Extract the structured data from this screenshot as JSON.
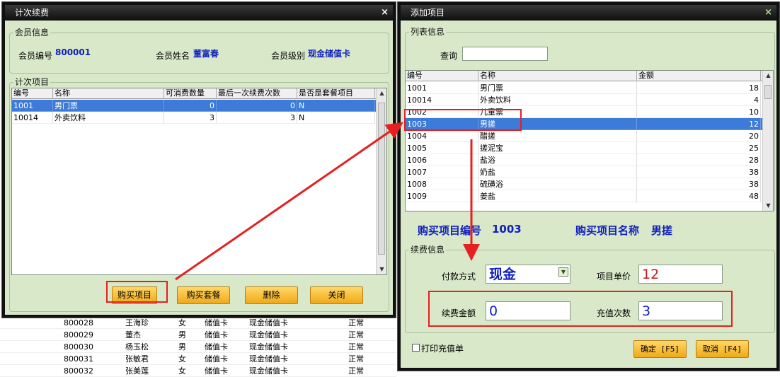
{
  "background_table": {
    "rows": [
      {
        "id": "800028",
        "name": "王海珍",
        "gender": "女",
        "card": "储值卡",
        "type": "现金储值卡",
        "status": "正常"
      },
      {
        "id": "800029",
        "name": "董杰",
        "gender": "男",
        "card": "储值卡",
        "type": "现金储值卡",
        "status": "正常"
      },
      {
        "id": "800030",
        "name": "杨玉松",
        "gender": "男",
        "card": "储值卡",
        "type": "现金储值卡",
        "status": "正常"
      },
      {
        "id": "800031",
        "name": "张敏君",
        "gender": "女",
        "card": "储值卡",
        "type": "现金储值卡",
        "status": "正常"
      },
      {
        "id": "800032",
        "name": "张美莲",
        "gender": "女",
        "card": "储值卡",
        "type": "现金储值卡",
        "status": "正常"
      }
    ]
  },
  "left_window": {
    "title": "计次续费",
    "close": "×",
    "member_group": {
      "legend": "会员信息",
      "id_label": "会员编号",
      "id_value": "800001",
      "name_label": "会员姓名",
      "name_value": "董富春",
      "level_label": "会员级别",
      "level_value": "现金储值卡"
    },
    "items_group": {
      "legend": "计次项目",
      "columns": [
        "编号",
        "名称",
        "可消费数量",
        "最后一次续费次数",
        "是否是套餐项目"
      ],
      "rows": [
        {
          "id": "1001",
          "name": "男门票",
          "qty": "0",
          "last": "0",
          "pkg": "N",
          "selected": true
        },
        {
          "id": "10014",
          "name": "外卖饮料",
          "qty": "3",
          "last": "3",
          "pkg": "N",
          "selected": false
        }
      ]
    },
    "buttons": {
      "buy_item": "购买项目",
      "buy_package": "购买套餐",
      "delete": "删除",
      "close": "关闭"
    }
  },
  "right_window": {
    "title": "添加项目",
    "close": "×",
    "list_group": {
      "legend": "列表信息",
      "query_label": "查询",
      "query_value": "",
      "columns": [
        "编号",
        "名称",
        "金额"
      ],
      "rows": [
        {
          "id": "1001",
          "name": "男门票",
          "amount": "18",
          "selected": false
        },
        {
          "id": "10014",
          "name": "外卖饮料",
          "amount": "4",
          "selected": false
        },
        {
          "id": "1002",
          "name": "儿童票",
          "amount": "10",
          "selected": false
        },
        {
          "id": "1003",
          "name": "男搓",
          "amount": "12",
          "selected": true
        },
        {
          "id": "1004",
          "name": "醋搓",
          "amount": "20",
          "selected": false
        },
        {
          "id": "1005",
          "name": "搓泥宝",
          "amount": "25",
          "selected": false
        },
        {
          "id": "1006",
          "name": "盐浴",
          "amount": "28",
          "selected": false
        },
        {
          "id": "1007",
          "name": "奶盐",
          "amount": "38",
          "selected": false
        },
        {
          "id": "1008",
          "name": "硫磺浴",
          "amount": "38",
          "selected": false
        },
        {
          "id": "1009",
          "name": "姜盐",
          "amount": "48",
          "selected": false
        }
      ]
    },
    "purchase": {
      "id_label": "购买项目编号",
      "id_value": "1003",
      "name_label": "购买项目名称",
      "name_value": "男搓"
    },
    "renew_group": {
      "legend": "续费信息",
      "pay_label": "付款方式",
      "pay_value": "现金",
      "price_label": "项目单价",
      "price_value": "12",
      "amount_label": "续费金额",
      "amount_value": "0",
      "count_label": "充值次数",
      "count_value": "3"
    },
    "print_label": "打印充值单",
    "ok_button": "确定 [F5]",
    "cancel_button": "取消 [F4]"
  },
  "colors": {
    "window_bg": "#d8e8c8",
    "title_bg": "#0e0e0e",
    "selection": "#3d7bd8",
    "accent_text": "#1020c0",
    "annotation_red": "#e62020",
    "button": "#f0a818"
  }
}
